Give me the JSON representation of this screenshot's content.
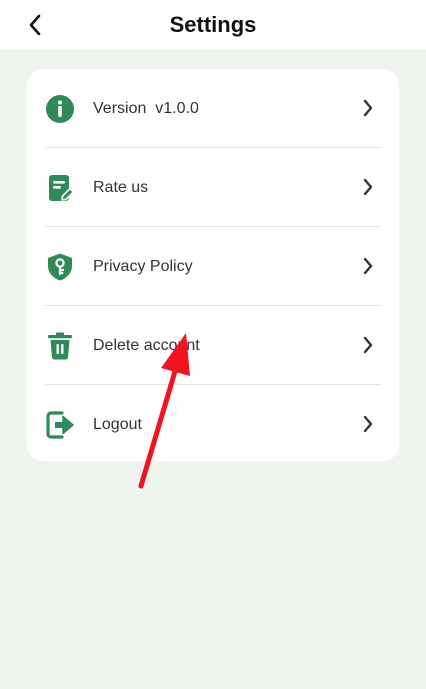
{
  "header": {
    "title": "Settings",
    "back_icon": "chevron-left-icon"
  },
  "settings": {
    "items": [
      {
        "label": "Version  v1.0.0",
        "icon": "info-circle-icon"
      },
      {
        "label": "Rate us",
        "icon": "edit-document-icon"
      },
      {
        "label": "Privacy Policy",
        "icon": "shield-key-icon"
      },
      {
        "label": "Delete account",
        "icon": "trash-icon"
      },
      {
        "label": "Logout",
        "icon": "logout-icon"
      }
    ]
  },
  "colors": {
    "accent": "#2f8a58",
    "background": "#eff4ee",
    "card": "#ffffff",
    "annotation_arrow": "#f0141e"
  }
}
